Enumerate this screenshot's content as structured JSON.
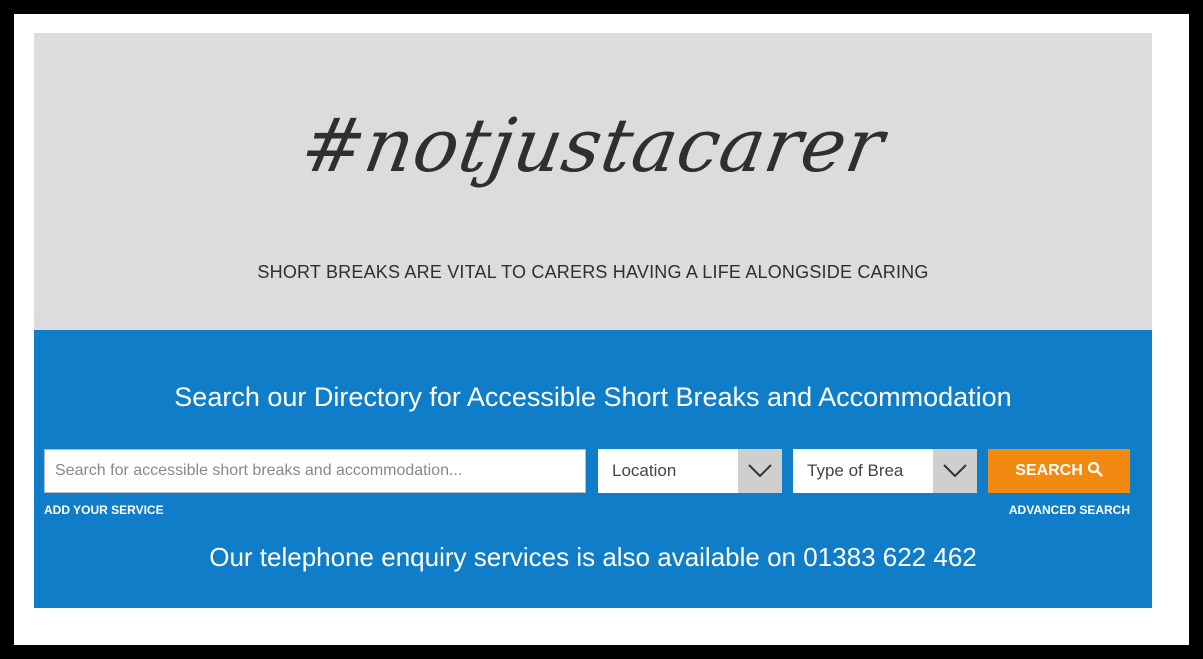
{
  "hero": {
    "hashtag": "#notjustacarer",
    "tagline": "SHORT BREAKS ARE VITAL TO CARERS HAVING A LIFE ALONGSIDE CARING"
  },
  "search": {
    "title": "Search our Directory for Accessible Short Breaks and Accommodation",
    "placeholder": "Search for accessible short breaks and accommodation...",
    "location_value": "Location",
    "type_value": "Type of Brea",
    "button_label": "SEARCH",
    "add_service": "ADD YOUR SERVICE",
    "advanced_search": "ADVANCED SEARCH",
    "telephone": "Our telephone enquiry services is also available on 01383 622 462"
  },
  "colors": {
    "hero_bg": "#dcdcdc",
    "panel_bg": "#0f7dc7",
    "button_bg": "#f28a11"
  },
  "icons": {
    "search": "search-icon",
    "dropdown": "chevron-down-icon"
  }
}
